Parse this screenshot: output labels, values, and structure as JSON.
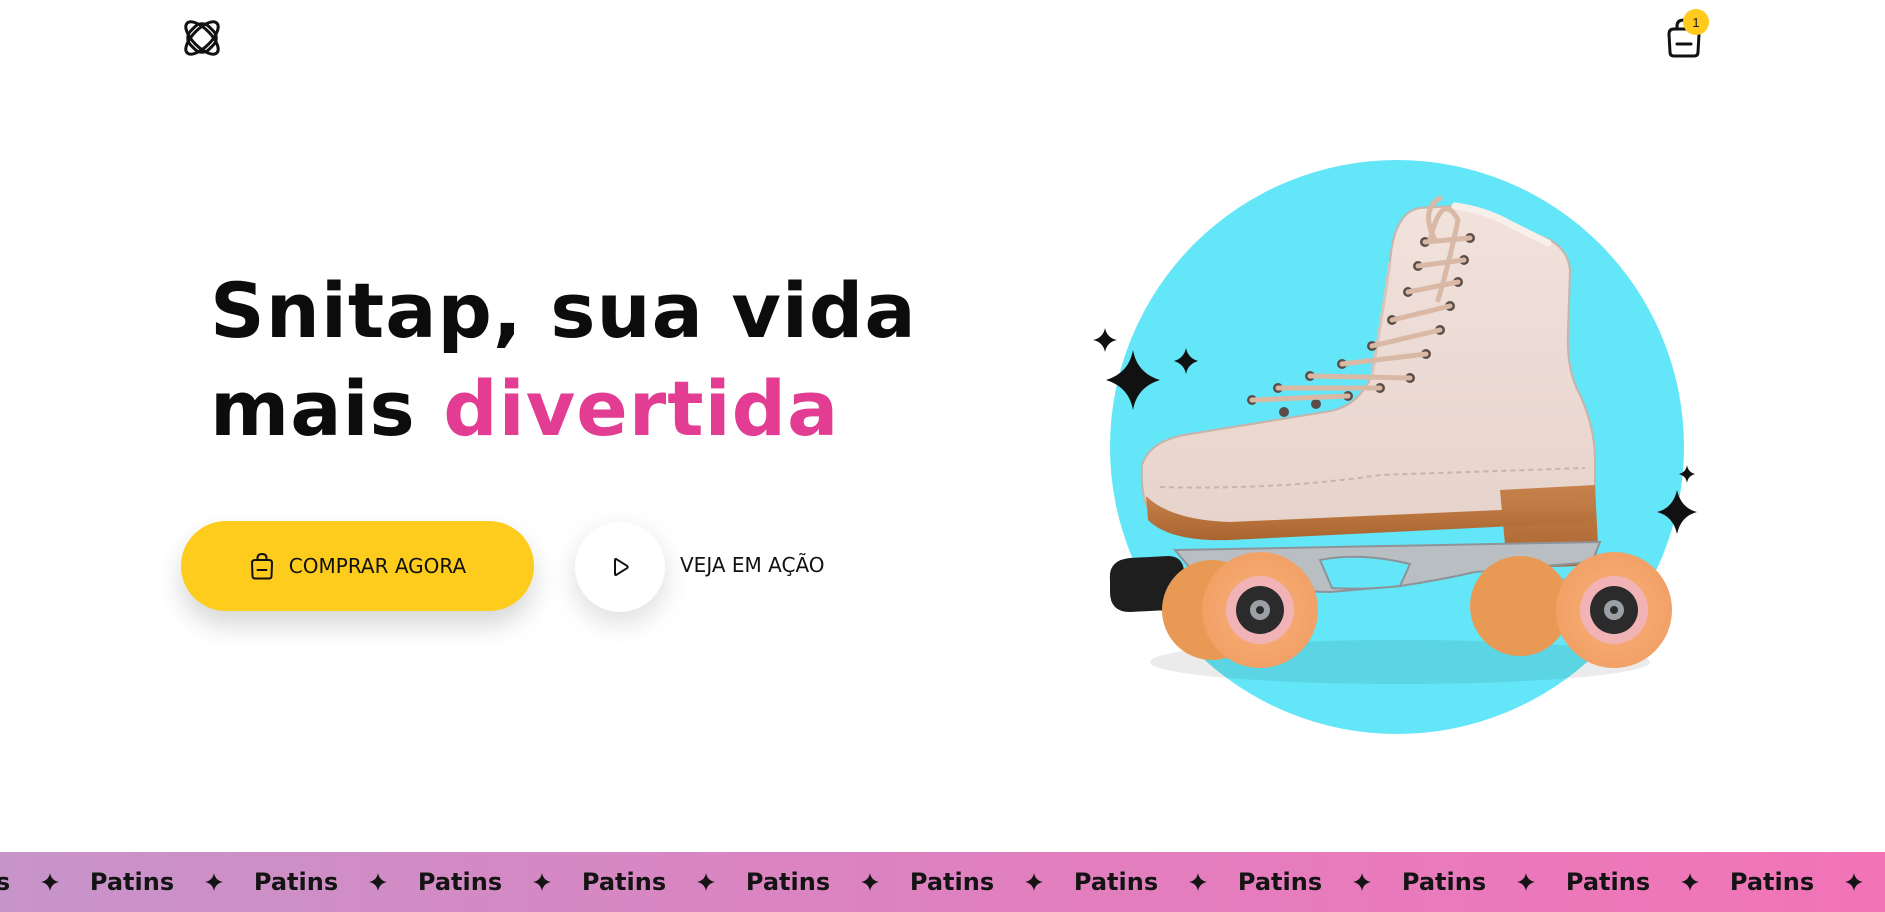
{
  "header": {
    "logo_icon": "snitap-logo-icon",
    "cart_icon": "shopping-bag-icon",
    "cart_count": "1"
  },
  "hero": {
    "headline_line1": "Snitap, sua vida",
    "headline_line2_plain": "mais ",
    "headline_line2_highlight": "divertida",
    "buy_button_label": "COMPRAR AGORA",
    "buy_button_icon": "shopping-bag-icon",
    "play_button_icon": "play-icon",
    "play_label": "VEJA EM AÇÃO",
    "image": "roller-skate-on-cyan-circle"
  },
  "marquee": {
    "word": "Patins",
    "separator_icon": "four-point-star-icon",
    "items": [
      "Patins",
      "Patins",
      "Patins",
      "Patins",
      "Patins",
      "Patins",
      "Patins",
      "Patins",
      "Patins",
      "Patins",
      "Patins",
      "Patins",
      "Patins"
    ]
  },
  "colors": {
    "accent_yellow": "#fdcc1c",
    "highlight_pink": "#e23d93",
    "circle_cyan": "#63e6f7",
    "marquee_gradient_start": "#c794c9",
    "marquee_gradient_end": "#f274b7"
  }
}
